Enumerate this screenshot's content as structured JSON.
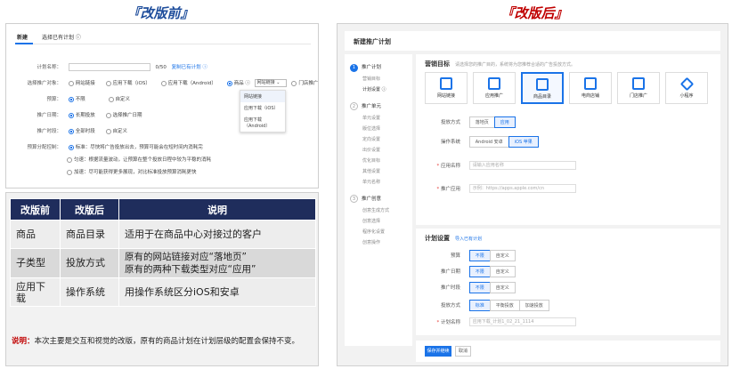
{
  "titles": {
    "before": "『改版前』",
    "after": "『改版后』"
  },
  "before": {
    "tabs": [
      "新建",
      "选择已有计划 ⓘ"
    ],
    "plan_name_label": "计划名称：",
    "plan_name_count": "0/50",
    "copy_link": "复制已有计划 ⓘ",
    "object_label": "选择推广对象：",
    "object_options": [
      "网站链接",
      "应用下载（iOS）",
      "应用下载（Android）",
      "商品 ⓘ",
      "门店推广"
    ],
    "select_value": "网站链接 ⌄",
    "dropdown": [
      "网站链接",
      "应用下载（iOS）",
      "应用下载（Android）"
    ],
    "budget_label": "预算：",
    "budget_options": [
      "不限",
      "自定义"
    ],
    "date_label": "推广日期：",
    "date_options": [
      "长期投放",
      "选择推广日期"
    ],
    "time_label": "推广时段：",
    "time_options": [
      "全部时段",
      "自定义"
    ],
    "alloc_label": "预算分配控制：",
    "alloc_options": [
      "标准：尽快将广告投放出去，预算可能会在短时间内消耗完",
      "匀速：根据流量波动，让预算在整个投放日程中较为平稳的消耗",
      "加速：尽可能获得更多展现，对比标准投放预算消耗更快"
    ]
  },
  "table": {
    "headers": [
      "改版前",
      "改版后",
      "说明"
    ],
    "rows": [
      [
        "商品",
        "商品目录",
        "适用于在商品中心对接过的客户"
      ],
      [
        "子类型",
        "投放方式",
        "原有的网站链接对应“落地页”\n原有的两种下载类型对应“应用”"
      ],
      [
        "应用下载",
        "操作系统",
        "用操作系统区分iOS和安卓"
      ]
    ],
    "note_key": "说明：",
    "note_text": "本次主要是交互和视觉的改版，原有的商品计划在计划层级的配置会保持不变。"
  },
  "after": {
    "header": "新建推广计划",
    "steps": [
      {
        "num": "1",
        "label": "推广计划",
        "subs": [
          "营销目标",
          "计划设置 ⓘ"
        ]
      },
      {
        "num": "2",
        "label": "推广单元",
        "subs": [
          "单元设置",
          "版位选择",
          "定向设置",
          "出价设置",
          "优化目标",
          "其他设置",
          "单元名称"
        ]
      },
      {
        "num": "3",
        "label": "推广创意",
        "subs": [
          "创意生成方式",
          "创意选择",
          "程序化设置",
          "创意操作"
        ]
      }
    ],
    "goal_title": "营销目标",
    "goal_hint": "请选择您的推广目的，系统将为您推荐合适的广告投放方式。",
    "goals": [
      "网站链接",
      "应用推广",
      "商品目录",
      "电商店铺",
      "门店推广",
      "小程序"
    ],
    "delivery_label": "投放方式",
    "delivery_options": [
      "落地页",
      "应用"
    ],
    "os_label": "操作系统",
    "os_options": [
      "Android 安卓",
      "iOS 苹果"
    ],
    "app_name_label": "应用名称",
    "app_name_placeholder": "请输入应用名称",
    "app_url_label": "推广应用",
    "app_url_placeholder": "示例：https://apps.apple.com/cn",
    "plan_title": "计划设置",
    "plan_link": "导入已有计划",
    "budget_label": "预算",
    "budget_options": [
      "不限",
      "自定义"
    ],
    "date_label": "推广日期",
    "date_options": [
      "不限",
      "自定义"
    ],
    "time_label": "推广时段",
    "time_options": [
      "不限",
      "自定义"
    ],
    "pace_label": "投放方式",
    "pace_options": [
      "标准",
      "平衡投放",
      "加速投放"
    ],
    "plan_name_label": "计划名称",
    "plan_name_placeholder": "应用下载_计划1_02_21_1114",
    "submit": "保存并继续",
    "cancel": "取消"
  }
}
